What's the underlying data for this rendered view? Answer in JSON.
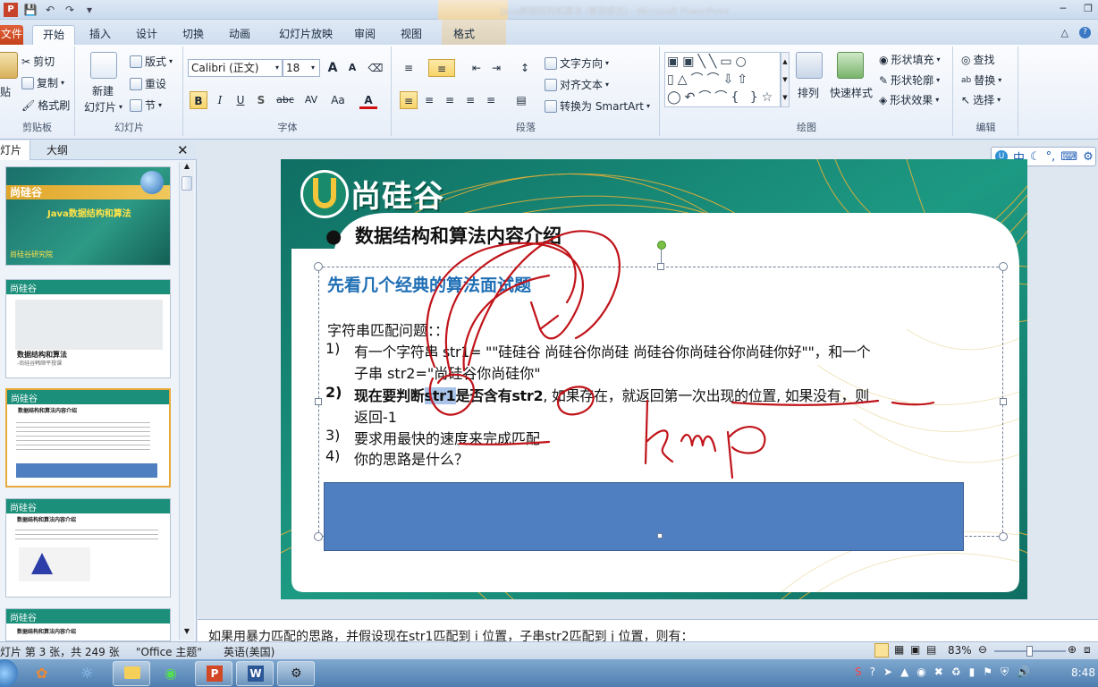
{
  "window": {
    "doc_title": "Java数据结构和算法 (兼容模式) - Microsoft PowerPoint",
    "format_tab": "格式"
  },
  "tabs": [
    "文件",
    "开始",
    "插入",
    "设计",
    "切换",
    "动画",
    "幻灯片放映",
    "审阅",
    "视图"
  ],
  "ribbon": {
    "clipboard": {
      "paste": "贴",
      "cut": "剪切",
      "copy": "复制",
      "format_painter": "格式刷",
      "label": "剪贴板"
    },
    "slides": {
      "new_slide_1": "新建",
      "new_slide_2": "幻灯片",
      "layout": "版式",
      "reset": "重设",
      "section": "节",
      "label": "幻灯片"
    },
    "font": {
      "font_name": "Calibri (正文)",
      "font_size": "18",
      "bold": "B",
      "italic": "I",
      "underline": "U",
      "shadow": "S",
      "strike": "abc",
      "spacing": "AV",
      "case": "Aa",
      "color": "A",
      "grow": "A",
      "shrink": "A",
      "label": "字体"
    },
    "paragraph": {
      "text_direction": "文字方向",
      "align_text": "对齐文本",
      "smartart": "转换为 SmartArt",
      "label": "段落"
    },
    "drawing": {
      "arrange": "排列",
      "quick_styles": "快速样式",
      "shape_fill": "形状填充",
      "shape_outline": "形状轮廓",
      "shape_effects": "形状效果",
      "label": "绘图"
    },
    "editing": {
      "find": "查找",
      "replace": "替换",
      "select": "选择",
      "label": "编辑"
    }
  },
  "leftpane": {
    "tab_slides": "灯片",
    "tab_outline": "大纲",
    "thumbs": [
      {
        "title": "Java数据结构和算法",
        "sub": "尚硅谷研究院"
      },
      {
        "title": "数据结构和算法",
        "sub": "-尚硅谷韩顺平授课"
      },
      {
        "title": "数据结构和算法内容介绍"
      },
      {
        "title": "数据结构和算法内容介绍"
      },
      {
        "title": "数据结构和算法内容介绍"
      }
    ]
  },
  "slide": {
    "logo": "尚硅谷",
    "bullet_title": "数据结构和算法内容介绍",
    "subtitle": "先看几个经典的算法面试题",
    "intro": "字符串匹配问题：：",
    "items": [
      {
        "num": "1)",
        "line1": "有一个字符串 str1= \"\"硅硅谷 尚硅谷你尚硅 尚硅谷你尚硅谷你尚硅你好\"\"，和一个",
        "line2": "子串 str2=\"尚硅谷你尚硅你\""
      },
      {
        "num": "2)",
        "bold1": "现在要判断",
        "hl": "str1",
        "bold2": "是否含有",
        "bold3": "str2",
        "rest1": ", 如果存在，就返回",
        "u1": "第一次出现的位置",
        "rest2": ", ",
        "u2": "如果没有",
        "rest3": "，则",
        "line2": "返回-1"
      },
      {
        "num": "3)",
        "line1": "要求用最快的速度来完成匹配"
      },
      {
        "num": "4)",
        "line1": "你的思路是什么？"
      }
    ],
    "handwriting": "kmp"
  },
  "ime": {
    "label": "中"
  },
  "notes": "如果用暴力匹配的思路，并假设现在str1匹配到 i 位置，子串str2匹配到 j 位置，则有：",
  "status": {
    "slide_info": "灯片 第 3 张，共 249 张",
    "theme": "\"Office 主题\"",
    "lang": "英语(美国)",
    "zoom": "83%"
  },
  "taskbar": {
    "clock": "8:48"
  },
  "colors": {
    "accent_teal": "#1b8f7a",
    "subtitle_blue": "#1f6fb5",
    "shape_blue": "#4f7fc1",
    "ink_red": "#c0141a"
  }
}
